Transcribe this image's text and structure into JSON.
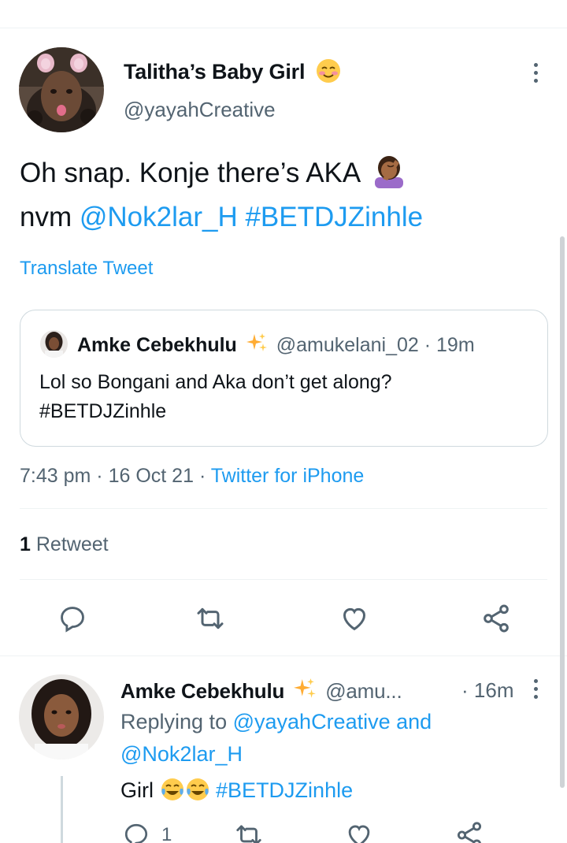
{
  "main_tweet": {
    "display_name": "Talitha’s Baby Girl",
    "name_emoji": "smiling-face-with-blush",
    "handle": "@yayahCreative",
    "text_plain": "Oh snap. Konje there’s AKA",
    "text_emoji": "facepalm-emoji",
    "text_nvm": "nvm",
    "mention": "@Nok2lar_H",
    "hashtag": "#BETDJZinhle",
    "translate": "Translate Tweet",
    "time": "7:43 pm",
    "date": "16 Oct 21",
    "source": "Twitter for iPhone",
    "retweet_count": "1",
    "retweet_label": "Retweet"
  },
  "quoted_tweet": {
    "display_name": "Amke Cebekhulu",
    "name_emoji": "sparkles",
    "handle": "@amukelani_02",
    "time": "19m",
    "text_line1": "Lol so Bongani and Aka don’t get along?",
    "text_line2": "#BETDJZinhle"
  },
  "reply_tweet": {
    "display_name": "Amke Cebekhulu",
    "name_emoji": "sparkles",
    "handle": "@amu...",
    "time": "16m",
    "replying_prefix": "Replying to",
    "replying_user1": "@yayahCreative",
    "replying_and": "and",
    "replying_user2": "@Nok2lar_H",
    "text": "Girl",
    "text_emoji": "tears-of-joy x2",
    "hashtag": "#BETDJZinhle",
    "reply_count": "1"
  },
  "separator": "·",
  "colors": {
    "link": "#1d9bf0",
    "secondary_text": "#536471",
    "primary_text": "#0f1419",
    "border": "#cfd9de"
  }
}
